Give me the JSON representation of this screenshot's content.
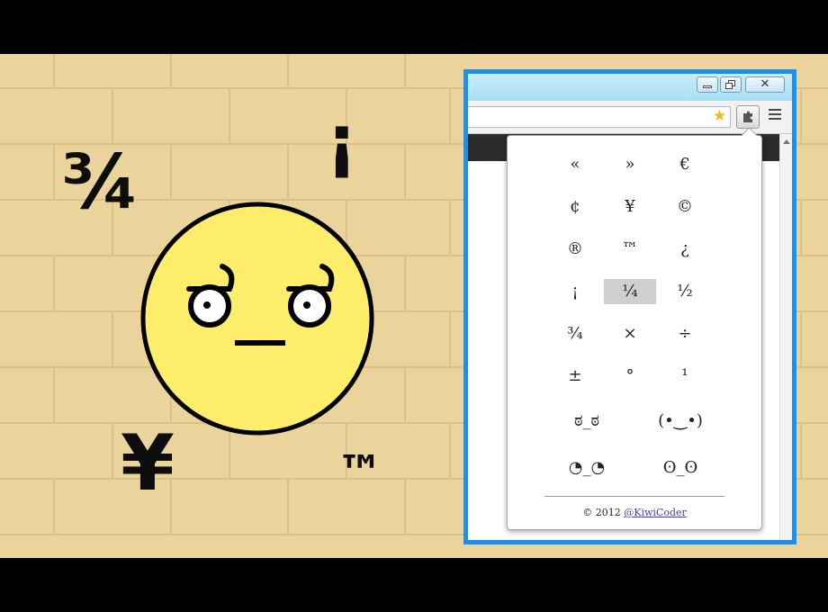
{
  "scene": {
    "decor_symbols": [
      "¾",
      "¡",
      "¥",
      "™"
    ],
    "face_character": "ಠ_ಠ",
    "colors": {
      "wall": "#ebd49c",
      "face": "#fded6b",
      "frame": "#1b8ff0",
      "band": "#000000"
    }
  },
  "browser": {
    "window_controls": [
      "minimize-icon",
      "restore-icon",
      "close-icon"
    ],
    "toolbar_icons": [
      "star-icon",
      "puzzle-piece-icon",
      "menu-icon"
    ]
  },
  "popup": {
    "characters": [
      "«",
      "»",
      "€",
      "¢",
      "¥",
      "©",
      "®",
      "™",
      "¿",
      "¡",
      "¼",
      "½",
      "¾",
      "×",
      "÷",
      "±",
      "°",
      "¹"
    ],
    "highlighted": "¼",
    "faces": [
      "ಠ_ಠ",
      "(•‿•)",
      "◔_◔",
      "ʘ_ʘ"
    ],
    "footer_prefix": "© 2012",
    "footer_link": "@KiwiCoder"
  }
}
